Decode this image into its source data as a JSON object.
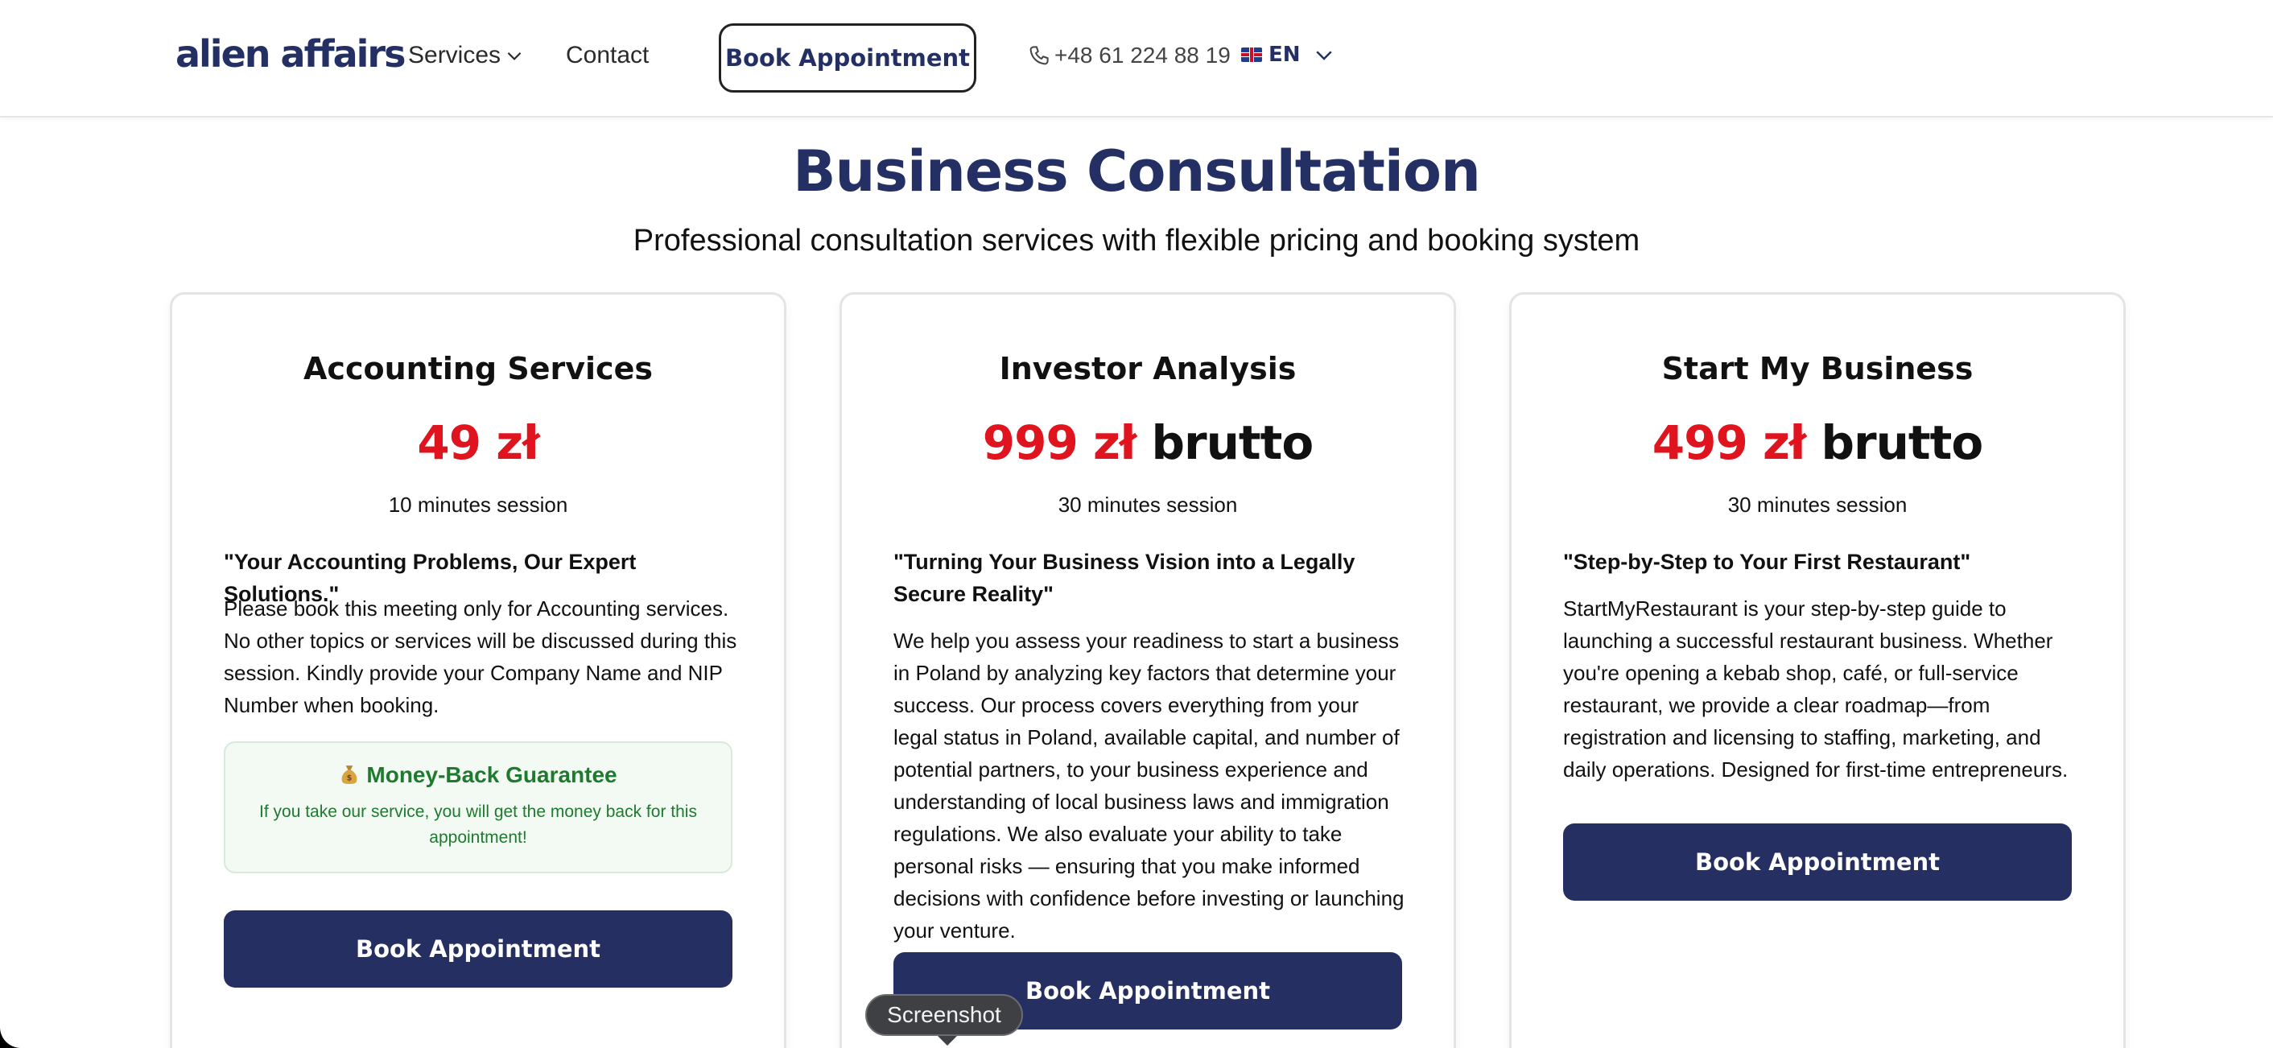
{
  "header": {
    "logo": "alien affairs",
    "nav_services": "Services",
    "nav_contact": "Contact",
    "book_label": "Book Appointment",
    "phone": "+48 61 224 88 19",
    "language": "EN"
  },
  "hero": {
    "title": "Business Consultation",
    "subtitle": "Professional consultation services with flexible pricing and booking system"
  },
  "cards": [
    {
      "title": "Accounting Services",
      "price": "49 zł",
      "price_suffix": "",
      "duration": "10 minutes session",
      "tagline": "\"Your Accounting Problems, Our Expert Solutions.\"",
      "description": "Please book this meeting only for Accounting services. No other topics or services will be discussed during this session. Kindly provide your Company Name and NIP Number when booking.",
      "guarantee_title": "Money-Back Guarantee",
      "guarantee_text": "If you take our service, you will get the money back for this appointment!",
      "button": "Book Appointment"
    },
    {
      "title": "Investor Analysis",
      "price": "999 zł",
      "price_suffix": "brutto",
      "duration": "30 minutes session",
      "tagline": "\"Turning Your Business Vision into a Legally Secure Reality\"",
      "description": "We help you assess your readiness to start a business in Poland by analyzing key factors that determine your success. Our process covers everything from your legal status in Poland, available capital, and number of potential partners, to your business experience and understanding of local business laws and immigration regulations. We also evaluate your ability to take personal risks — ensuring that you make informed decisions with confidence before investing or launching your venture.",
      "button": "Book Appointment"
    },
    {
      "title": "Start My Business",
      "price": "499 zł",
      "price_suffix": "brutto",
      "duration": "30 minutes session",
      "tagline": "\"Step-by-Step to Your First Restaurant\"",
      "description": "StartMyRestaurant is your step-by-step guide to launching a successful restaurant business. Whether you're opening a kebab shop, café, or full-service restaurant, we provide a clear roadmap—from registration and licensing to staffing, marketing, and daily operations. Designed for first-time entrepreneurs.",
      "button": "Book Appointment"
    }
  ],
  "tooltip": "Screenshot",
  "colors": {
    "brand_navy": "#243063",
    "button_navy": "#262f62",
    "price_red": "#e0141e",
    "guarantee_green": "#1e7a2e"
  }
}
